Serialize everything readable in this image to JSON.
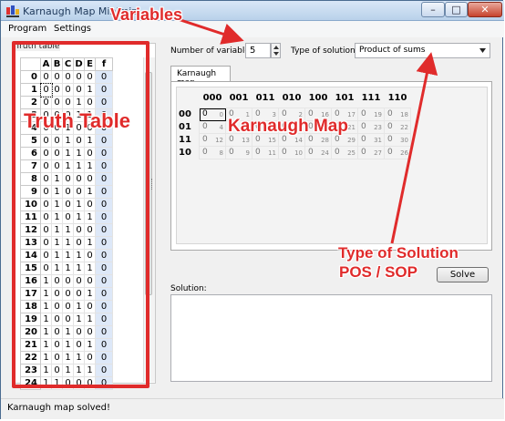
{
  "window": {
    "title": "Karnaugh Map Minimiz",
    "minimize_glyph": "–",
    "maximize_glyph": "□",
    "close_glyph": "✕"
  },
  "menu": [
    "Program",
    "Settings"
  ],
  "truth_table": {
    "label": "Truth table",
    "columns": [
      "A",
      "B",
      "C",
      "D",
      "E",
      "f"
    ],
    "rows": [
      {
        "i": "0",
        "bits": [
          "0",
          "0",
          "0",
          "0",
          "0"
        ],
        "f": "0"
      },
      {
        "i": "1",
        "bits": [
          "0",
          "0",
          "0",
          "0",
          "1"
        ],
        "f": "0"
      },
      {
        "i": "2",
        "bits": [
          "0",
          "0",
          "0",
          "1",
          "0"
        ],
        "f": "0"
      },
      {
        "i": "3",
        "bits": [
          "0",
          "0",
          "0",
          "1",
          "1"
        ],
        "f": "0"
      },
      {
        "i": "4",
        "bits": [
          "0",
          "0",
          "1",
          "0",
          "0"
        ],
        "f": "0"
      },
      {
        "i": "5",
        "bits": [
          "0",
          "0",
          "1",
          "0",
          "1"
        ],
        "f": "0"
      },
      {
        "i": "6",
        "bits": [
          "0",
          "0",
          "1",
          "1",
          "0"
        ],
        "f": "0"
      },
      {
        "i": "7",
        "bits": [
          "0",
          "0",
          "1",
          "1",
          "1"
        ],
        "f": "0"
      },
      {
        "i": "8",
        "bits": [
          "0",
          "1",
          "0",
          "0",
          "0"
        ],
        "f": "0"
      },
      {
        "i": "9",
        "bits": [
          "0",
          "1",
          "0",
          "0",
          "1"
        ],
        "f": "0"
      },
      {
        "i": "10",
        "bits": [
          "0",
          "1",
          "0",
          "1",
          "0"
        ],
        "f": "0"
      },
      {
        "i": "11",
        "bits": [
          "0",
          "1",
          "0",
          "1",
          "1"
        ],
        "f": "0"
      },
      {
        "i": "12",
        "bits": [
          "0",
          "1",
          "1",
          "0",
          "0"
        ],
        "f": "0"
      },
      {
        "i": "13",
        "bits": [
          "0",
          "1",
          "1",
          "0",
          "1"
        ],
        "f": "0"
      },
      {
        "i": "14",
        "bits": [
          "0",
          "1",
          "1",
          "1",
          "0"
        ],
        "f": "0"
      },
      {
        "i": "15",
        "bits": [
          "0",
          "1",
          "1",
          "1",
          "1"
        ],
        "f": "0"
      },
      {
        "i": "16",
        "bits": [
          "1",
          "0",
          "0",
          "0",
          "0"
        ],
        "f": "0"
      },
      {
        "i": "17",
        "bits": [
          "1",
          "0",
          "0",
          "0",
          "1"
        ],
        "f": "0"
      },
      {
        "i": "18",
        "bits": [
          "1",
          "0",
          "0",
          "1",
          "0"
        ],
        "f": "0"
      },
      {
        "i": "19",
        "bits": [
          "1",
          "0",
          "0",
          "1",
          "1"
        ],
        "f": "0"
      },
      {
        "i": "20",
        "bits": [
          "1",
          "0",
          "1",
          "0",
          "0"
        ],
        "f": "0"
      },
      {
        "i": "21",
        "bits": [
          "1",
          "0",
          "1",
          "0",
          "1"
        ],
        "f": "0"
      },
      {
        "i": "22",
        "bits": [
          "1",
          "0",
          "1",
          "1",
          "0"
        ],
        "f": "0"
      },
      {
        "i": "23",
        "bits": [
          "1",
          "0",
          "1",
          "1",
          "1"
        ],
        "f": "0"
      },
      {
        "i": "24",
        "bits": [
          "1",
          "1",
          "0",
          "0",
          "0"
        ],
        "f": "0"
      }
    ]
  },
  "controls": {
    "num_vars_label": "Number of variables:",
    "num_vars_value": "5",
    "solution_type_label": "Type of solution:",
    "solution_type_value": "Product of sums",
    "tab_label": "Karnaugh map",
    "solve_label": "Solve",
    "solution_label": "Solution:"
  },
  "kmap": {
    "col_headers": [
      "000",
      "001",
      "011",
      "010",
      "100",
      "101",
      "111",
      "110"
    ],
    "rows": [
      {
        "label": "00",
        "cells": [
          {
            "v": "0",
            "i": "0"
          },
          {
            "v": "0",
            "i": "1"
          },
          {
            "v": "0",
            "i": "3"
          },
          {
            "v": "0",
            "i": "2"
          },
          {
            "v": "0",
            "i": "16"
          },
          {
            "v": "0",
            "i": "17"
          },
          {
            "v": "0",
            "i": "19"
          },
          {
            "v": "0",
            "i": "18"
          }
        ]
      },
      {
        "label": "01",
        "cells": [
          {
            "v": "0",
            "i": "4"
          },
          {
            "v": "0",
            "i": "5"
          },
          {
            "v": "0",
            "i": "7"
          },
          {
            "v": "0",
            "i": "6"
          },
          {
            "v": "0",
            "i": "20"
          },
          {
            "v": "0",
            "i": "21"
          },
          {
            "v": "0",
            "i": "23"
          },
          {
            "v": "0",
            "i": "22"
          }
        ]
      },
      {
        "label": "11",
        "cells": [
          {
            "v": "0",
            "i": "12"
          },
          {
            "v": "0",
            "i": "13"
          },
          {
            "v": "0",
            "i": "15"
          },
          {
            "v": "0",
            "i": "14"
          },
          {
            "v": "0",
            "i": "28"
          },
          {
            "v": "0",
            "i": "29"
          },
          {
            "v": "0",
            "i": "31"
          },
          {
            "v": "0",
            "i": "30"
          }
        ]
      },
      {
        "label": "10",
        "cells": [
          {
            "v": "0",
            "i": "8"
          },
          {
            "v": "0",
            "i": "9"
          },
          {
            "v": "0",
            "i": "11"
          },
          {
            "v": "0",
            "i": "10"
          },
          {
            "v": "0",
            "i": "24"
          },
          {
            "v": "0",
            "i": "25"
          },
          {
            "v": "0",
            "i": "27"
          },
          {
            "v": "0",
            "i": "26"
          }
        ]
      }
    ]
  },
  "annotations": {
    "variables": "Variables",
    "truth_table": "Truth Table",
    "karnaugh_map": "Karnaugh Map",
    "type_of_solution_line1": "Type of Solution",
    "type_of_solution_line2": "POS / SOP",
    "color": "#e02b2b"
  },
  "status": "Karnaugh map solved!"
}
